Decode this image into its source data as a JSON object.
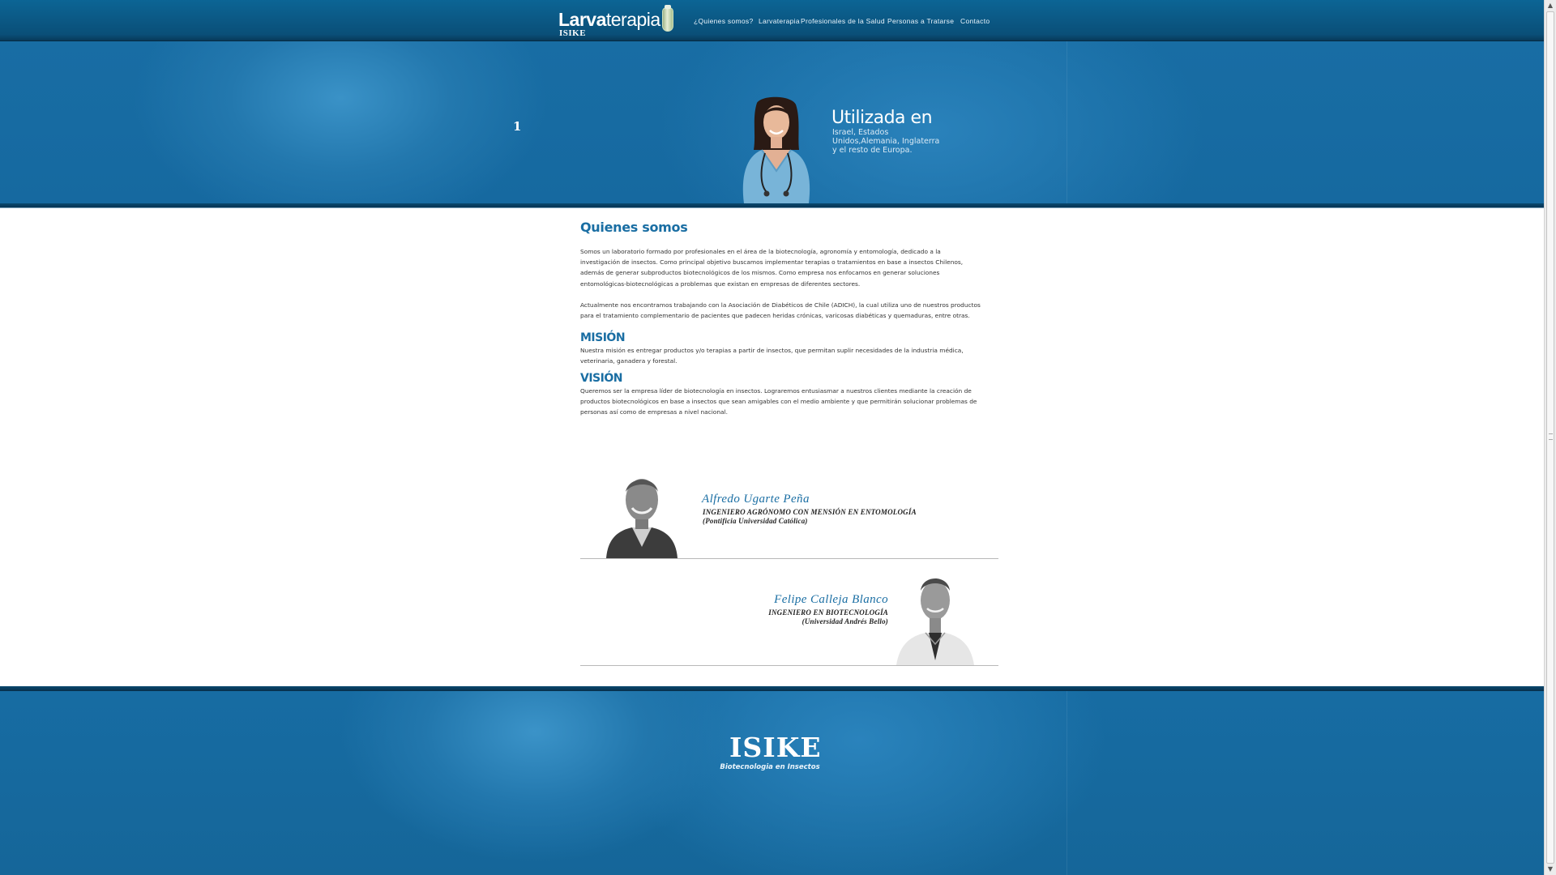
{
  "header": {
    "logo_bold": "Larva",
    "logo_rest": "terapia",
    "logo_sub": "ISIKE",
    "nav": [
      {
        "label": "¿Quienes somos?"
      },
      {
        "label": "Larvaterapia"
      },
      {
        "label": "Profesionales de la Salud"
      },
      {
        "label": "Personas a Tratarse"
      },
      {
        "label": "Contacto"
      }
    ]
  },
  "hero": {
    "slide_number": "1",
    "title": "Utilizada en",
    "text": "Israel, Estados Unidos,Alemania, Inglaterra y el resto de Europa."
  },
  "main": {
    "title": "Quienes somos",
    "paragraphs": [
      "Somos un laboratorio formado por profesionales en el área de la biotecnología, agronomía y entomología, dedicado a la investigación de insectos. Como principal objetivo buscamos implementar terapias o tratamientos en base a insectos Chilenos, además de generar subproductos biotecnológicos de los mismos. Como empresa nos enfocamos en generar soluciones entomológicas-biotecnológicas a problemas que existan en empresas de diferentes sectores.",
      "Actualmente nos encontramos trabajando con la Asociación de Diabéticos de Chile (ADICH), la cual utiliza uno de nuestros productos para el tratamiento complementario de pacientes que padecen heridas crónicas, varicosas diabéticas y quemaduras, entre otras."
    ],
    "mision_title": "MISIÓN",
    "mision_text": "Nuestra misión es entregar productos y/o terapias a partir de insectos, que permitan suplir necesidades de la industria médica, veterinaria, ganadera y forestal.",
    "vision_title": "VISIÓN",
    "vision_text": "Queremos ser la empresa líder de biotecnología en insectos. Lograremos entusiasmar a nuestros clientes mediante la creación de productos biotecnológicos en base a insectos que sean amigables con el medio ambiente y que permitirán solucionar problemas de personas así como de empresas a nivel nacional."
  },
  "team": [
    {
      "name": "Alfredo Ugarte Peña",
      "role": "INGENIERO AGRÓNOMO CON MENSIÓN EN ENTOMOLOGÍA",
      "org": "(Pontificia Universidad Católica)"
    },
    {
      "name": "Felipe Calleja Blanco",
      "role": "INGENIERO EN BIOTECNOLOGÍA",
      "org": "(Universidad Andrés Bello)"
    }
  ],
  "footer": {
    "logo": "ISIKE",
    "tagline": "Biotecnologia en Insectos"
  },
  "colors": {
    "accent": "#1a6ea3",
    "header_bg": "#0a4f78",
    "hero_bg": "#1669a0"
  }
}
